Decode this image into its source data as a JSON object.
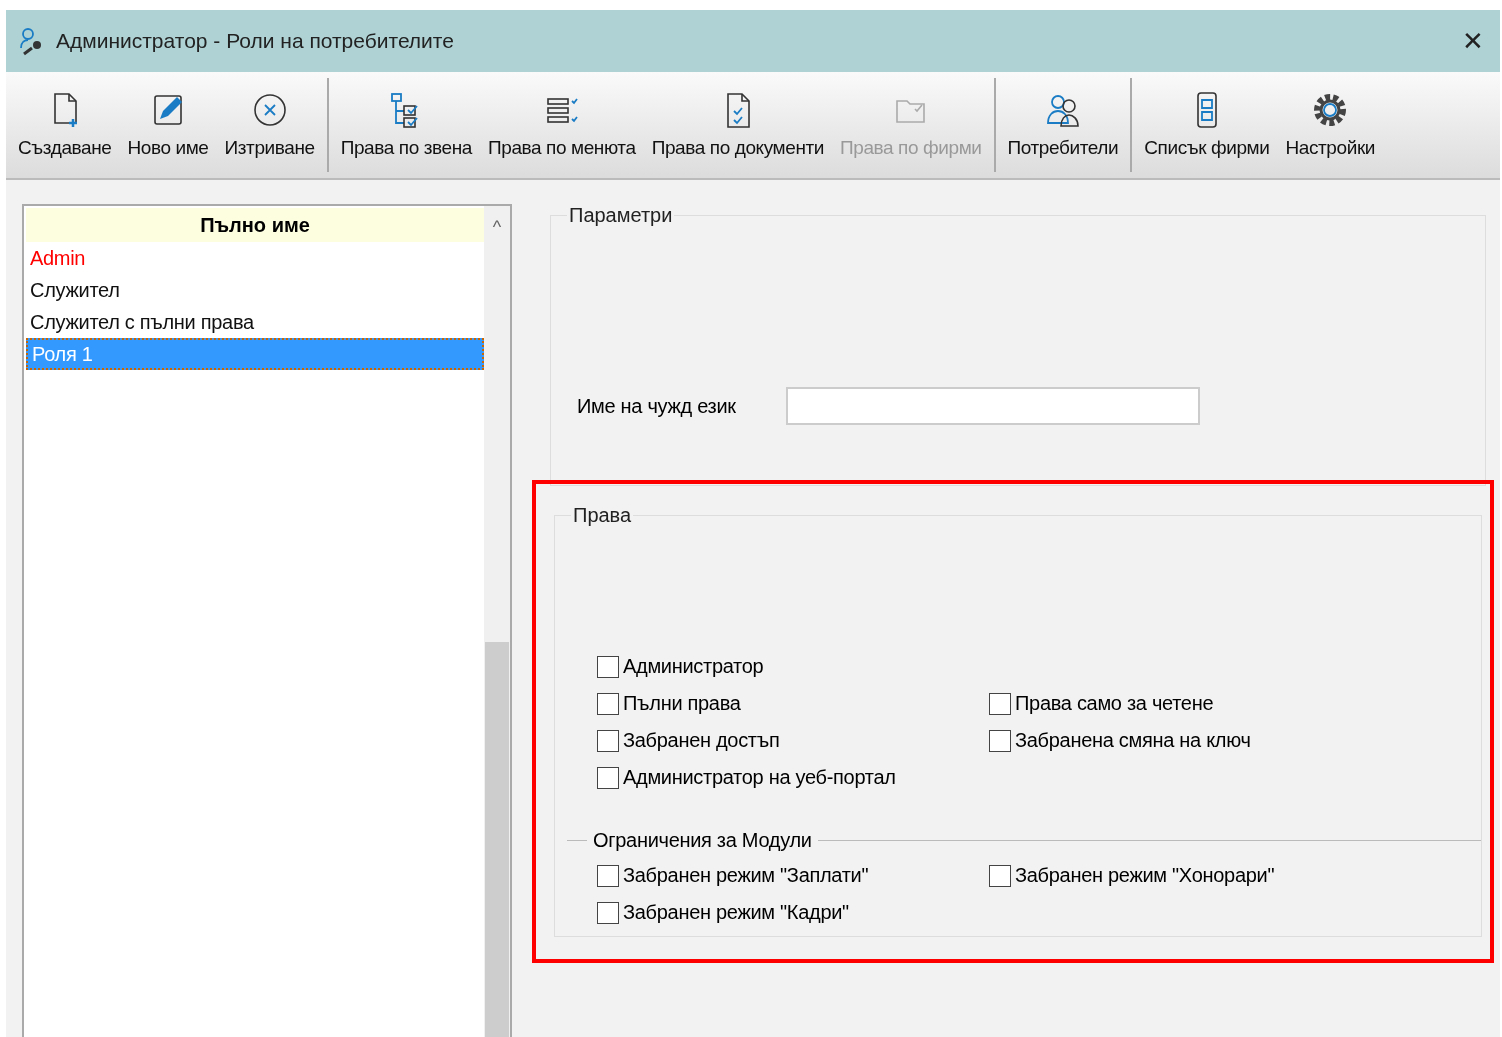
{
  "window": {
    "title": "Администратор - Роли на потребителите",
    "close": "✕"
  },
  "toolbar": {
    "groups": [
      [
        {
          "label": "Създаване",
          "kind": "new",
          "disabled": false
        },
        {
          "label": "Ново име",
          "kind": "edit",
          "disabled": false
        },
        {
          "label": "Изтриване",
          "kind": "delete",
          "disabled": false
        }
      ],
      [
        {
          "label": "Права по звена",
          "kind": "tree",
          "disabled": false
        },
        {
          "label": "Права по менюта",
          "kind": "menu",
          "disabled": false
        },
        {
          "label": "Права по документи",
          "kind": "doc",
          "disabled": false
        },
        {
          "label": "Права по фирми",
          "kind": "folder",
          "disabled": true
        }
      ],
      [
        {
          "label": "Потребители",
          "kind": "users",
          "disabled": false
        }
      ],
      [
        {
          "label": "Списък фирми",
          "kind": "list",
          "disabled": false
        },
        {
          "label": "Настройки",
          "kind": "gear",
          "disabled": false
        }
      ]
    ]
  },
  "roles": {
    "column": "Пълно име",
    "sort": "^",
    "rows": [
      {
        "name": "Admin",
        "kind": "system",
        "selected": false
      },
      {
        "name": "Служител",
        "kind": "role",
        "selected": false
      },
      {
        "name": "Служител с пълни права",
        "kind": "role",
        "selected": false
      },
      {
        "name": "Роля 1",
        "kind": "role",
        "selected": true
      }
    ]
  },
  "parameters": {
    "title": "Параметри",
    "foreign_name": {
      "label": "Име на чужд език"
    }
  },
  "rights": {
    "title": "Права",
    "rows": [
      [
        {
          "label": "Администратор",
          "checked": false
        }
      ],
      [
        {
          "label": "Пълни права",
          "checked": false
        },
        {
          "label": "Права само за четене",
          "checked": false
        }
      ],
      [
        {
          "label": "Забранен достъп",
          "checked": false
        },
        {
          "label": "Забранена смяна на ключ",
          "checked": false
        }
      ],
      [
        {
          "label": "Администратор на уеб-портал",
          "checked": false
        }
      ]
    ],
    "modules": {
      "title": "Ограничения за Модули",
      "rows": [
        [
          {
            "label": "Забранен режим \"Заплати\"",
            "checked": false
          },
          {
            "label": "Забранен режим \"Хонорари\"",
            "checked": false
          }
        ],
        [
          {
            "label": "Забранен режим \"Кадри\"",
            "checked": false
          }
        ]
      ]
    }
  }
}
